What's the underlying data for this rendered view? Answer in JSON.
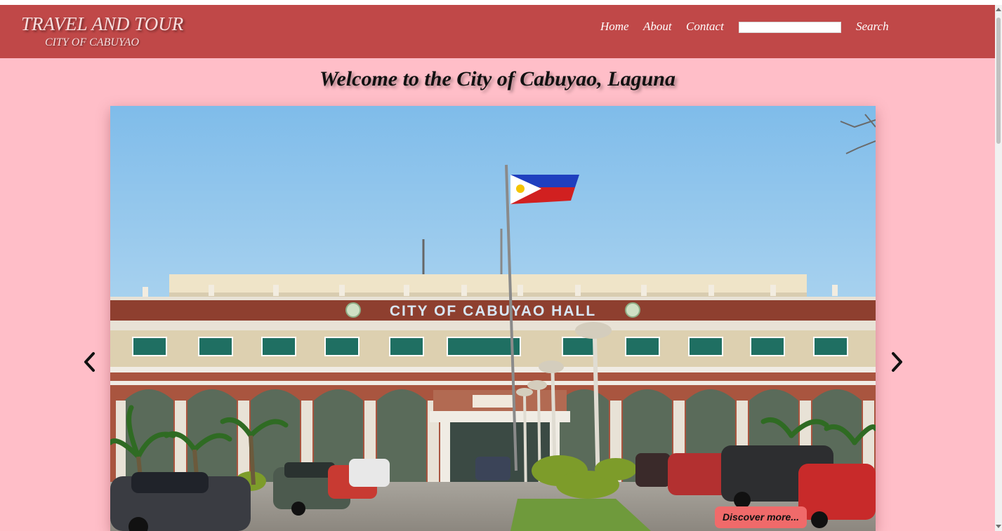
{
  "header": {
    "brand_title": "TRAVEL AND TOUR",
    "brand_subtitle": "CITY OF CABUYAO",
    "nav": [
      {
        "label": "Home"
      },
      {
        "label": "About"
      },
      {
        "label": "Contact"
      }
    ],
    "search": {
      "value": "",
      "button_label": "Search"
    }
  },
  "main": {
    "welcome_title": "Welcome to the City of Cabuyao, Laguna",
    "slide": {
      "image_sign_text": "CITY OF CABUYAO HALL",
      "discover_label": "Discover more..."
    },
    "prev_icon": "chevron-left-icon",
    "next_icon": "chevron-right-icon"
  },
  "colors": {
    "header_bg": "#c04848",
    "page_bg": "#ffbec8",
    "discover_bg": "#f06a6a"
  }
}
